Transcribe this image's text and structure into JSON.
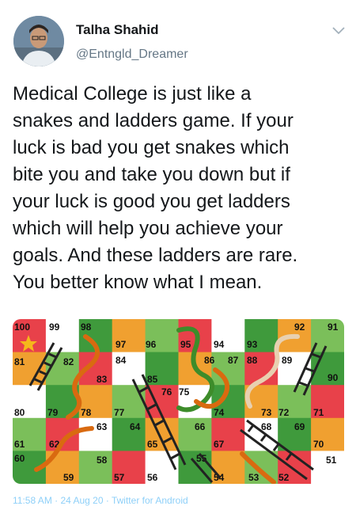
{
  "author": {
    "name": "Talha Shahid",
    "handle": "@Entngld_Dreamer"
  },
  "tweet": {
    "text": "Medical College is just like a\nsnakes and ladders game. If your\nluck is bad you get snakes which\nbite you and take you down but if\nyour luck is good you get ladders\nwhich will help you achieve your\ngoals. And these ladders are rare.\nYou better know what I mean."
  },
  "board": {
    "numbers": [
      "100",
      "99",
      "98",
      "97",
      "96",
      "95",
      "94",
      "93",
      "92",
      "91",
      "81",
      "82",
      "84",
      "86",
      "87",
      "88",
      "89",
      "90",
      "83",
      "85",
      "76",
      "75",
      "80",
      "79",
      "78",
      "77",
      "74",
      "73",
      "72",
      "71",
      "63",
      "64",
      "66",
      "68",
      "69",
      "61",
      "62",
      "65",
      "67",
      "70",
      "60",
      "58",
      "55",
      "51",
      "59",
      "57",
      "56",
      "54",
      "53",
      "52"
    ],
    "colors": {
      "red": "#e8414a",
      "green": "#3f9a3c",
      "lightgreen": "#7bbf5a",
      "orange": "#f0a030",
      "white": "#ffffff",
      "snake": "#e07a1c"
    }
  },
  "footer": {
    "text": "11:58 AM · 24 Aug 20 · Twitter for Android"
  }
}
